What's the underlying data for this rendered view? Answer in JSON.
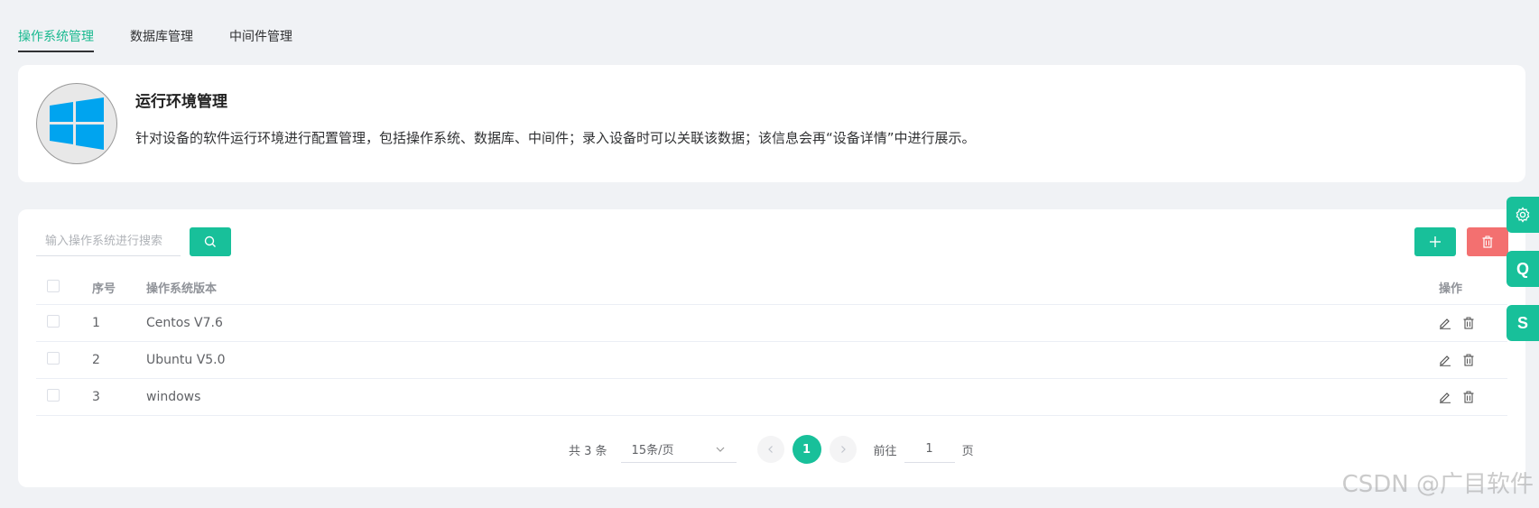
{
  "tabs": [
    {
      "label": "操作系统管理",
      "active": true
    },
    {
      "label": "数据库管理",
      "active": false
    },
    {
      "label": "中间件管理",
      "active": false
    }
  ],
  "intro": {
    "title": "运行环境管理",
    "description": "针对设备的软件运行环境进行配置管理，包括操作系统、数据库、中间件；录入设备时可以关联该数据；该信息会再“设备详情”中进行展示。"
  },
  "search": {
    "placeholder": "输入操作系统进行搜索",
    "value": ""
  },
  "table": {
    "headers": {
      "no": "序号",
      "version": "操作系统版本",
      "op": "操作"
    },
    "rows": [
      {
        "no": "1",
        "version": "Centos V7.6"
      },
      {
        "no": "2",
        "version": "Ubuntu V5.0"
      },
      {
        "no": "3",
        "version": "windows"
      }
    ]
  },
  "pagination": {
    "total": "共 3 条",
    "page_size": "15条/页",
    "current_page": "1",
    "goto_label": "前往",
    "goto_value": "1",
    "page_unit": "页"
  },
  "side_buttons": [
    {
      "icon": "gear-icon",
      "label": ""
    },
    {
      "icon": "",
      "label": "Q"
    },
    {
      "icon": "",
      "label": "S"
    }
  ],
  "watermark": "CSDN @广目软件",
  "colors": {
    "accent": "#18c09a",
    "danger": "#f37070",
    "tab_active": "#18b98f",
    "windows_blue": "#00a4ef"
  }
}
